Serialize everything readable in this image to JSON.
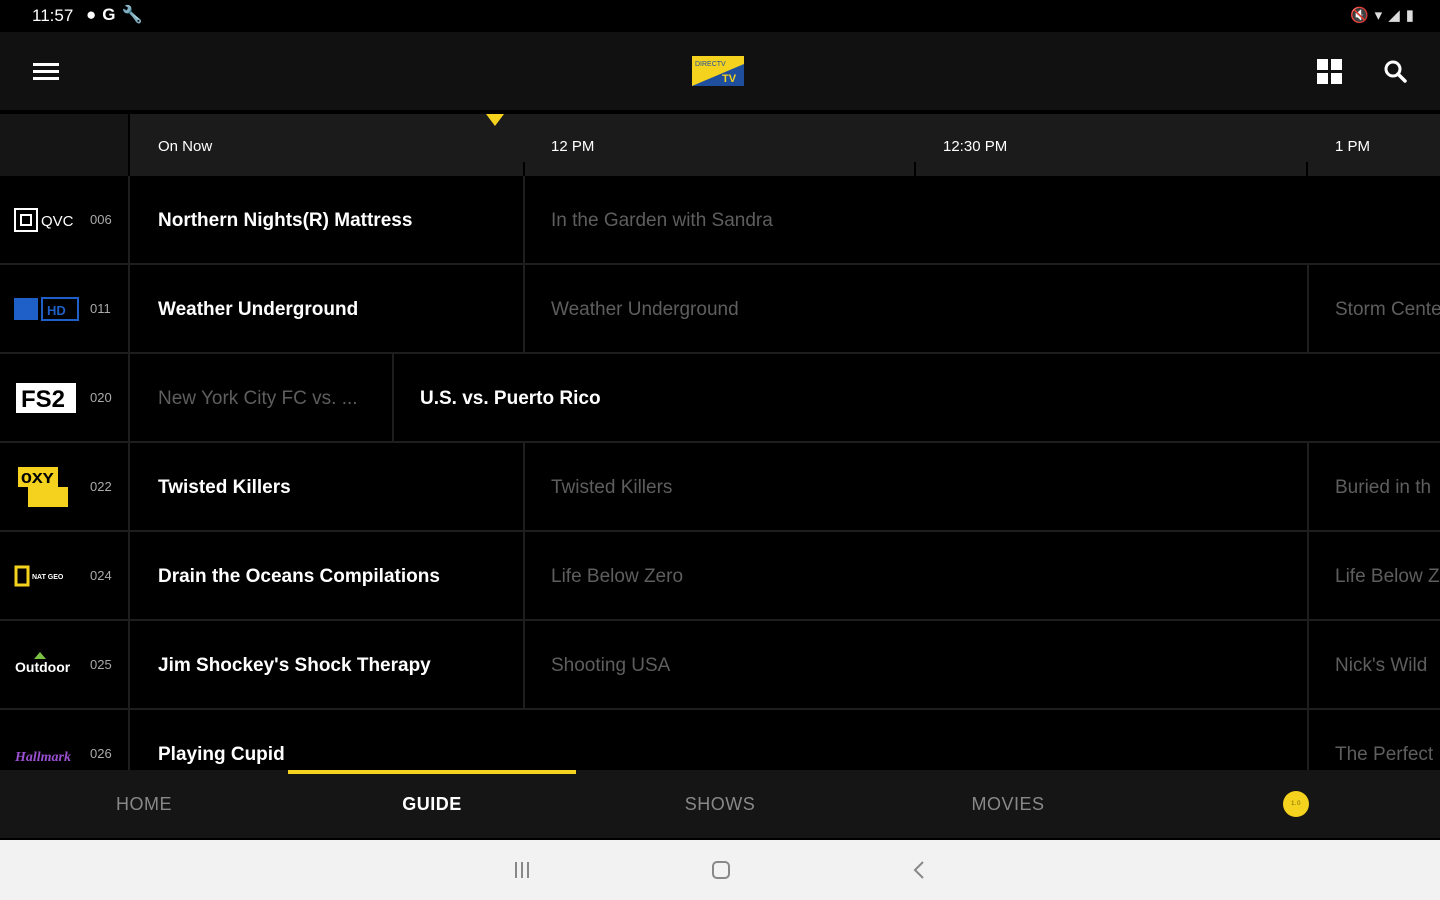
{
  "status_bar": {
    "time": "11:57",
    "left_icons": [
      "notification-dot-icon",
      "google-icon",
      "wrench-icon"
    ],
    "right_icons": [
      "mute-icon",
      "wifi-icon",
      "signal-icon",
      "battery-icon"
    ]
  },
  "app_bar": {
    "logo_text_top": "DIRECTV",
    "logo_text_bottom": "TV",
    "icons": [
      "menu-icon",
      "grid-icon",
      "search-icon"
    ]
  },
  "timeline": {
    "labels": [
      "On Now",
      "12 PM",
      "12:30 PM",
      "1 PM"
    ]
  },
  "channels": [
    {
      "logo": "QVC",
      "number": "006",
      "programs": [
        {
          "title": "Northern Nights(R) Mattress",
          "state": "on"
        },
        {
          "title": "In the Garden with Sandra",
          "state": "later"
        }
      ]
    },
    {
      "logo": "HD",
      "number": "011",
      "programs": [
        {
          "title": "Weather Underground",
          "state": "on"
        },
        {
          "title": "Weather Underground",
          "state": "later"
        },
        {
          "title": "Storm Cente",
          "state": "later"
        }
      ]
    },
    {
      "logo": "FS2",
      "number": "020",
      "programs": [
        {
          "title": "New York City FC vs. ...",
          "state": "later"
        },
        {
          "title": "U.S. vs. Puerto Rico",
          "state": "on"
        }
      ]
    },
    {
      "logo": "OXY GEN",
      "number": "022",
      "programs": [
        {
          "title": "Twisted Killers",
          "state": "on"
        },
        {
          "title": "Twisted Killers",
          "state": "later"
        },
        {
          "title": "Buried in th",
          "state": "later"
        }
      ]
    },
    {
      "logo": "NAT GEO",
      "number": "024",
      "programs": [
        {
          "title": "Drain the Oceans Compilations",
          "state": "on"
        },
        {
          "title": "Life Below Zero",
          "state": "later"
        },
        {
          "title": "Life Below Z",
          "state": "later"
        }
      ]
    },
    {
      "logo": "Outdoor",
      "number": "025",
      "programs": [
        {
          "title": "Jim Shockey's Shock Therapy",
          "state": "on"
        },
        {
          "title": "Shooting USA",
          "state": "later"
        },
        {
          "title": "Nick's Wild",
          "state": "later"
        }
      ]
    },
    {
      "logo": "Hallmark",
      "number": "026",
      "programs": [
        {
          "title": "Playing Cupid",
          "state": "on"
        },
        {
          "title": "The Perfect",
          "state": "later"
        }
      ]
    }
  ],
  "tabs": [
    {
      "label": "HOME",
      "active": false
    },
    {
      "label": "GUIDE",
      "active": true
    },
    {
      "label": "SHOWS",
      "active": false
    },
    {
      "label": "MOVIES",
      "active": false
    }
  ],
  "profile_avatar_text": "1.0",
  "colors": {
    "accent": "#f4d21e",
    "background": "#000000",
    "on_now_text": "#ffffff",
    "later_text": "#5e5e5e"
  }
}
